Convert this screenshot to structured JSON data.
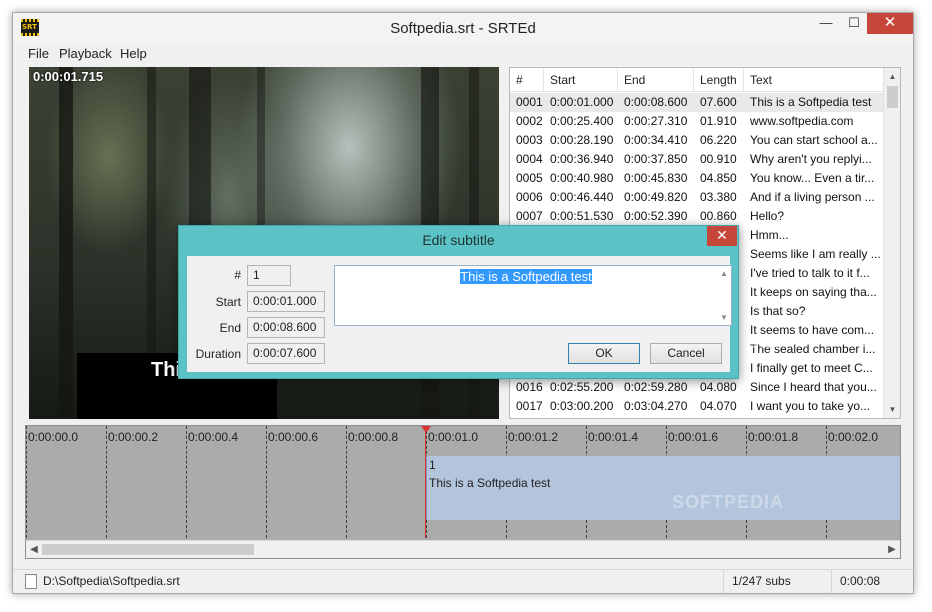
{
  "window": {
    "title": "Softpedia.srt - SRTEd",
    "icon_label": "SRT",
    "buttons": {
      "minimize": "—",
      "maximize": "☐",
      "close": "✕"
    }
  },
  "menu": [
    "File",
    "Playback",
    "Help"
  ],
  "video": {
    "time": "0:00:01.715",
    "subtitle_partial": "This"
  },
  "grid": {
    "columns": [
      "#",
      "Start",
      "End",
      "Length",
      "Text"
    ],
    "rows": [
      {
        "num": "0001",
        "start": "0:00:01.000",
        "end": "0:00:08.600",
        "length": "07.600",
        "text": "This is a Softpedia test",
        "selected": true
      },
      {
        "num": "0002",
        "start": "0:00:25.400",
        "end": "0:00:27.310",
        "length": "01.910",
        "text": "www.softpedia.com"
      },
      {
        "num": "0003",
        "start": "0:00:28.190",
        "end": "0:00:34.410",
        "length": "06.220",
        "text": "You can start school a..."
      },
      {
        "num": "0004",
        "start": "0:00:36.940",
        "end": "0:00:37.850",
        "length": "00.910",
        "text": "Why aren't you replyi..."
      },
      {
        "num": "0005",
        "start": "0:00:40.980",
        "end": "0:00:45.830",
        "length": "04.850",
        "text": "You know... Even a tir..."
      },
      {
        "num": "0006",
        "start": "0:00:46.440",
        "end": "0:00:49.820",
        "length": "03.380",
        "text": "And if a living person ..."
      },
      {
        "num": "0007",
        "start": "0:00:51.530",
        "end": "0:00:52.390",
        "length": "00.860",
        "text": "Hello?"
      },
      {
        "num": "",
        "start": "",
        "end": "",
        "length": "",
        "text": "Hmm..."
      },
      {
        "num": "",
        "start": "",
        "end": "",
        "length": "",
        "text": "Seems like I am really ..."
      },
      {
        "num": "",
        "start": "",
        "end": "",
        "length": "",
        "text": "I've tried to talk to it f..."
      },
      {
        "num": "",
        "start": "",
        "end": "",
        "length": "",
        "text": "It keeps on saying tha..."
      },
      {
        "num": "",
        "start": "",
        "end": "",
        "length": "",
        "text": "Is that so?"
      },
      {
        "num": "",
        "start": "",
        "end": "",
        "length": "",
        "text": "It seems to have com..."
      },
      {
        "num": "",
        "start": "",
        "end": "",
        "length": "",
        "text": "The sealed chamber i..."
      },
      {
        "num": "",
        "start": "",
        "end": "",
        "length": "",
        "text": "I finally get to meet C..."
      },
      {
        "num": "0016",
        "start": "0:02:55.200",
        "end": "0:02:59.280",
        "length": "04.080",
        "text": "Since I heard that you..."
      },
      {
        "num": "0017",
        "start": "0:03:00.200",
        "end": "0:03:04.270",
        "length": "04.070",
        "text": "I want you to take yo..."
      }
    ]
  },
  "timeline": {
    "ticks": [
      "0:00:00.0",
      "0:00:00.2",
      "0:00:00.4",
      "0:00:00.6",
      "0:00:00.8",
      "0:00:01.0",
      "0:00:01.2",
      "0:00:01.4",
      "0:00:01.6",
      "0:00:01.8",
      "0:00:02.0"
    ],
    "block_num": "1",
    "block_text": "This is a Softpedia test"
  },
  "status": {
    "path": "D:\\Softpedia\\Softpedia.srt",
    "count": "1/247 subs",
    "time": "0:00:08"
  },
  "dialog": {
    "title": "Edit subtitle",
    "labels": {
      "num": "#",
      "start": "Start",
      "end": "End",
      "duration": "Duration"
    },
    "values": {
      "num": "1",
      "start": "0:00:01.000",
      "end": "0:00:08.600",
      "duration": "0:00:07.600"
    },
    "text": "This is a Softpedia test",
    "ok": "OK",
    "cancel": "Cancel"
  },
  "watermark": "SOFTPEDIA",
  "colors": {
    "dialog_title": "#5bc3c6",
    "close_red": "#c7463a",
    "timeline_block": "#b3c4dd",
    "playhead": "#d8332c",
    "selection": "#3399ff"
  }
}
